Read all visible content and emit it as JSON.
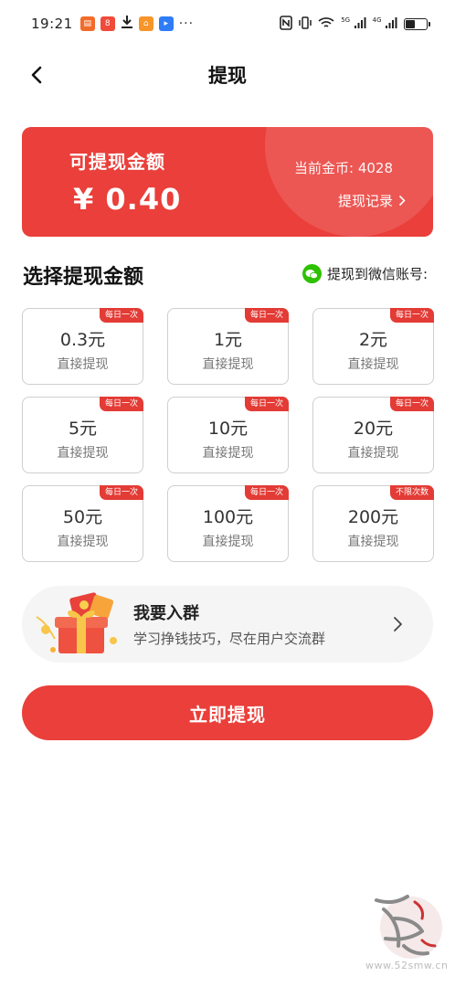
{
  "status_bar": {
    "time": "19:21",
    "more": "···",
    "network_left": "5G",
    "network_right": "4G"
  },
  "nav": {
    "title": "提现"
  },
  "balance_card": {
    "label": "可提现金额",
    "amount": "¥ 0.40",
    "coins": "当前金币: 4028",
    "record_link": "提现记录"
  },
  "section": {
    "title": "选择提现金额",
    "wechat_label": "提现到微信账号:"
  },
  "options": [
    {
      "amount": "0.3元",
      "desc": "直接提现",
      "badge": "每日一次"
    },
    {
      "amount": "1元",
      "desc": "直接提现",
      "badge": "每日一次"
    },
    {
      "amount": "2元",
      "desc": "直接提现",
      "badge": "每日一次"
    },
    {
      "amount": "5元",
      "desc": "直接提现",
      "badge": "每日一次"
    },
    {
      "amount": "10元",
      "desc": "直接提现",
      "badge": "每日一次"
    },
    {
      "amount": "20元",
      "desc": "直接提现",
      "badge": "每日一次"
    },
    {
      "amount": "50元",
      "desc": "直接提现",
      "badge": "每日一次"
    },
    {
      "amount": "100元",
      "desc": "直接提现",
      "badge": "每日一次"
    },
    {
      "amount": "200元",
      "desc": "直接提现",
      "badge": "不限次数"
    }
  ],
  "group_banner": {
    "title": "我要入群",
    "subtitle": "学习挣钱技巧，尽在用户交流群"
  },
  "submit_label": "立即提现",
  "watermark": {
    "logo_text": "吾爱首码",
    "url": "www.52smw.cn"
  },
  "colors": {
    "accent": "#ea3f3a",
    "badge": "#e33b35",
    "wechat": "#2dc100"
  }
}
